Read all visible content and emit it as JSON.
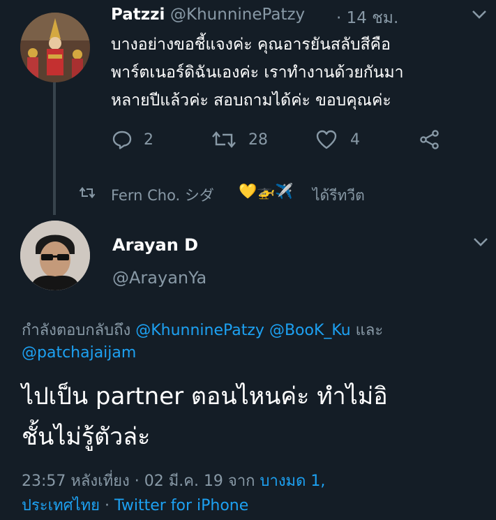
{
  "tweet1": {
    "display_name": "Patzzi",
    "handle": "@KhunninePatzy",
    "time": "· 14 ชม.",
    "text": "บางอย่างขอชี้แจงค่ะ คุณอารยันสลับสีคือพาร์ตเนอร์ดิฉันเองค่ะ เราทำงานด้วยกันมาหลายปีแล้วค่ะ สอบถามได้ค่ะ ขอบคุณค่ะ",
    "lines": [
      "บางอย่างขอชี้แจงค่ะ คุณอารยันสลับสีคือ",
      "พาร์ตเนอร์ดิฉันเองค่ะ เราทำงานด้วยกันมา",
      "หลายปีแล้วค่ะ สอบถามได้ค่ะ ขอบคุณค่ะ"
    ],
    "replies": "2",
    "retweets": "28",
    "likes": "4"
  },
  "retweet_notice": {
    "name": "Fern Cho. シダ",
    "emoji": "💛🚁✈️",
    "suffix": "ได้รีทวีต"
  },
  "tweet2": {
    "display_name": "Arayan D",
    "handle": "@ArayanYa",
    "replying_prefix": "กำลังตอบกลับถึง",
    "mention1": "@KhunninePatzy",
    "mention2": "@BooK_Ku",
    "and_word": "และ",
    "mention3": "@patchajaijam",
    "text_line1": "ไปเป็น partner ตอนไหนค่ะ ทำไม่อิ",
    "text_line2": "ชั้นไม่รู้ตัวล่ะ",
    "timestamp": "23:57 หลังเที่ยง · 02 มี.ค. 19 จาก",
    "location1": "บางมด 1,",
    "location2": "ประเทศไทย",
    "sep": "·",
    "client": "Twitter for iPhone"
  },
  "colors": {
    "background": "#141d26",
    "muted": "#8899a6",
    "link": "#1da1f2",
    "heart_emoji": "#f5b324"
  }
}
